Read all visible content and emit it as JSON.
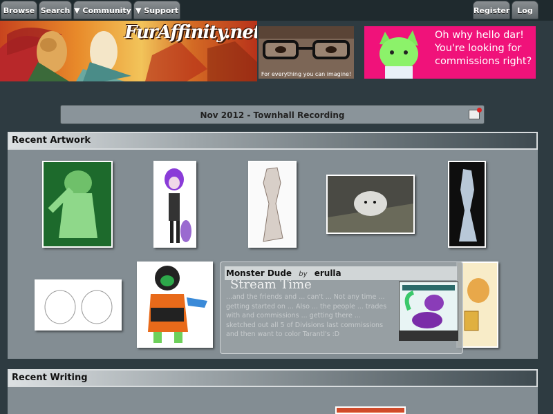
{
  "nav": {
    "browse": "Browse",
    "search": "Search",
    "community": "▼ Community",
    "support": "▼ Support",
    "register": "Register",
    "login": "Log In"
  },
  "banner": {
    "logo": "FurAffinity.net",
    "tagline": "For everything you can imagine!"
  },
  "ad": {
    "text": "Oh why hello dar! You're looking for commissions right?"
  },
  "townhall": {
    "title": "Nov 2012 - Townhall Recording"
  },
  "sections": {
    "artwork_title": "Recent Artwork",
    "writing_title": "Recent Writing"
  },
  "popup": {
    "title": "Monster Dude",
    "by": "by",
    "artist": "erulla",
    "stream_text": "Stream Time",
    "description": "...and the friends and ... can't ... Not any time ... getting started on ... Also ... the people ... trades with and commissions ... getting there ... sketched out all 5 of Divisions last commissions and then want to color Tarantl's :D"
  },
  "colors": {
    "page_bg": "#2e3b41",
    "section_bg": "#838d93",
    "ad_bg": "#f0127a"
  }
}
